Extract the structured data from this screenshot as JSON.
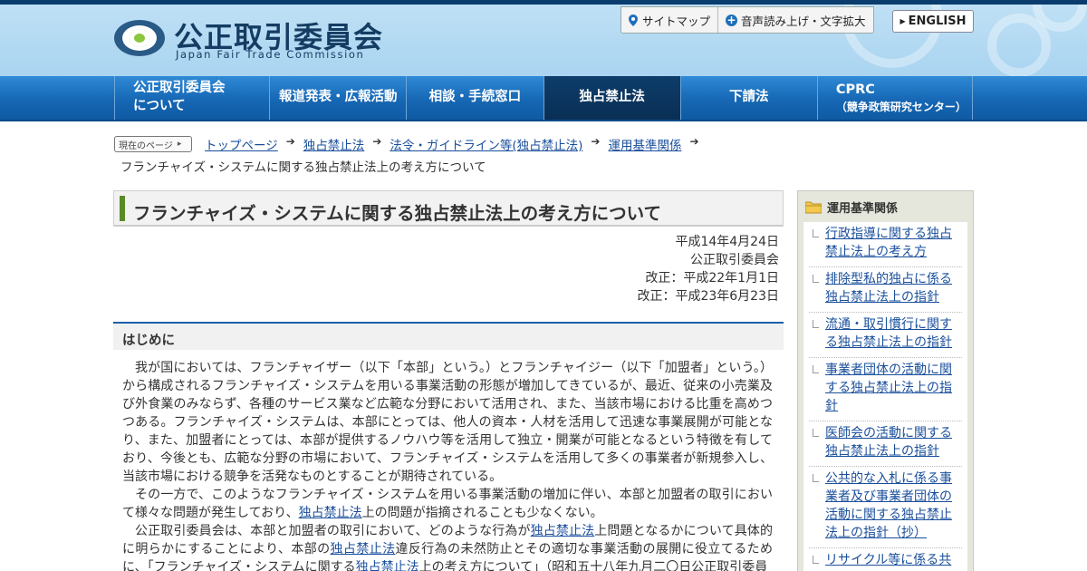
{
  "header": {
    "logo_jp": "公正取引委員会",
    "logo_en": "Japan Fair Trade Commission",
    "util": {
      "sitemap": "サイトマップ",
      "accessibility": "音声読み上げ・文字拡大"
    },
    "english": "ENGLISH"
  },
  "nav": {
    "items": [
      {
        "line1": "公正取引委員会",
        "line2": "について"
      },
      {
        "line1": "報道発表・広報活動",
        "line2": ""
      },
      {
        "line1": "相談・手続窓口",
        "line2": ""
      },
      {
        "line1": "独占禁止法",
        "line2": ""
      },
      {
        "line1": "下請法",
        "line2": ""
      },
      {
        "line1": "CPRC",
        "line2": "（競争政策研究センター）"
      }
    ]
  },
  "breadcrumb": {
    "badge": "現在のページ",
    "links": [
      "トップページ",
      "独占禁止法",
      "法令・ガイドライン等(独占禁止法)",
      "運用基準関係"
    ],
    "current": "フランチャイズ・システムに関する独占禁止法上の考え方について"
  },
  "main": {
    "title": "フランチャイズ・システムに関する独占禁止法上の考え方について",
    "meta": [
      "平成14年4月24日",
      "公正取引委員会",
      "改正：平成22年1月1日",
      "改正：平成23年6月23日"
    ],
    "section_title": "はじめに",
    "paragraphs": {
      "p1": "我が国においては、フランチャイザー（以下「本部」という。）とフランチャイジー（以下「加盟者」という。）から構成されるフランチャイズ・システムを用いる事業活動の形態が増加してきているが、最近、従来の小売業及び外食業のみならず、各種のサービス業など広範な分野において活用され、また、当該市場における比重を高めつつある。フランチャイズ・システムは、本部にとっては、他人の資本・人材を活用して迅速な事業展開が可能となり、また、加盟者にとっては、本部が提供するノウハウ等を活用して独立・開業が可能となるという特徴を有しており、今後とも、広範な分野の市場において、フランチャイズ・システムを活用して多くの事業者が新規参入し、当該市場における競争を活発なものとすることが期待されている。",
      "p2a": "その一方で、このようなフランチャイズ・システムを用いる事業活動の増加に伴い、本部と加盟者の取引において様々な問題が発生しており、",
      "p2link": "独占禁止法",
      "p2b": "上の問題が指摘されることも少なくない。",
      "p3a": "公正取引委員会は、本部と加盟者の取引において、どのような行為が",
      "p3link1": "独占禁止法",
      "p3b": "上問題となるかについて具体的に明らかにすることにより、本部の",
      "p3link2": "独占禁止法",
      "p3c": "違反行為の未然防止とその適切な事業活動の展開に役立てるために、「フランチャイズ・システムに関する",
      "p3link3": "独占禁止法",
      "p3d": "上の考え方について」（昭和五十八年九月二〇日公正取引委員"
    }
  },
  "sidebar": {
    "heading": "運用基準関係",
    "items": [
      "行政指導に関する独占禁止法上の考え方",
      "排除型私的独占に係る独占禁止法上の指針",
      "流通・取引慣行に関する独占禁止法上の指針",
      "事業者団体の活動に関する独占禁止法上の指針",
      "医師会の活動に関する独占禁止法上の指針",
      "公共的な入札に係る事業者及び事業者団体の活動に関する独占禁止法上の指針（抄）",
      "リサイクル等に係る共"
    ]
  },
  "colors": {
    "nav": "#1667b4",
    "accent_green": "#5a8a28",
    "link": "#1a4f9c"
  }
}
